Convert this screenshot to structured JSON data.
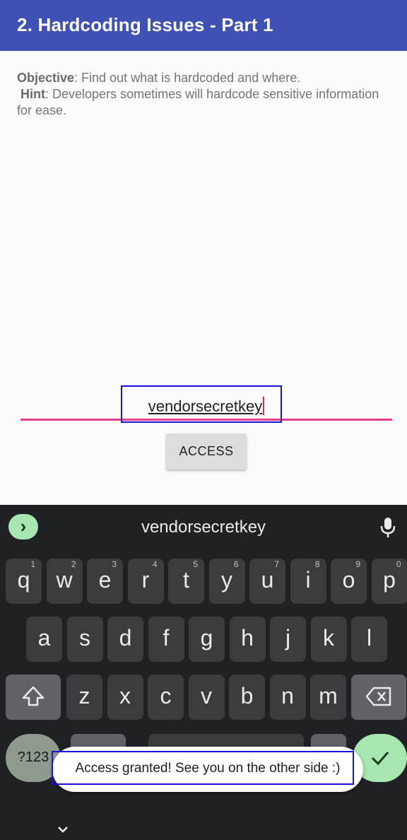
{
  "appbar": {
    "title": "2. Hardcoding Issues - Part 1"
  },
  "main": {
    "objective_label": "Objective",
    "objective_text": ": Find out what is hardcoded and where.",
    "hint_label": "Hint",
    "hint_text": ": Developers sometimes will hardcode sensitive information for ease.",
    "input_value": "vendorsecretkey",
    "access_button": "ACCESS"
  },
  "keyboard": {
    "suggestion": "vendorsecretkey",
    "row1": [
      {
        "k": "q",
        "h": "1"
      },
      {
        "k": "w",
        "h": "2"
      },
      {
        "k": "e",
        "h": "3"
      },
      {
        "k": "r",
        "h": "4"
      },
      {
        "k": "t",
        "h": "5"
      },
      {
        "k": "y",
        "h": "6"
      },
      {
        "k": "u",
        "h": "7"
      },
      {
        "k": "i",
        "h": "8"
      },
      {
        "k": "o",
        "h": "9"
      },
      {
        "k": "p",
        "h": "0"
      }
    ],
    "row2": [
      "a",
      "s",
      "d",
      "f",
      "g",
      "h",
      "j",
      "k",
      "l"
    ],
    "row3": [
      "z",
      "x",
      "c",
      "v",
      "b",
      "n",
      "m"
    ],
    "symbols_key": "?123"
  },
  "toast": {
    "text": "Access granted! See you on the other side :)"
  },
  "colors": {
    "appbar": "#3f51b5",
    "accent": "#e83e8c",
    "highlight_box": "#1a10e0"
  }
}
